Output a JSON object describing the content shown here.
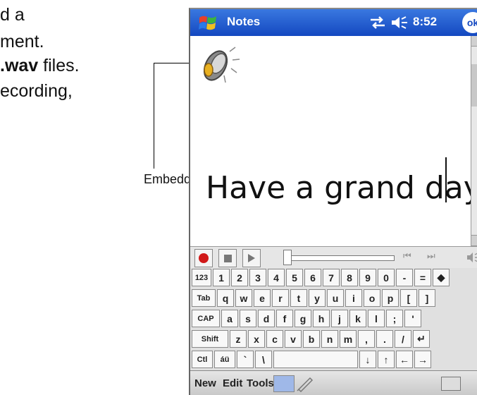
{
  "manual": {
    "line1": "d a",
    "line2": "ment.",
    "line3_bold": ".wav",
    "line3_rest": " files.",
    "line4": "ecording,",
    "callout_label": "Embedded recording"
  },
  "titlebar": {
    "app_title": "Notes",
    "time": "8:52",
    "ok_label": "ok"
  },
  "note": {
    "text": "Have a grand day!"
  },
  "recording_bar": {
    "skip_back": "⏮",
    "skip_forward": "⏭"
  },
  "keyboard": {
    "rows": [
      [
        "123",
        "1",
        "2",
        "3",
        "4",
        "5",
        "6",
        "7",
        "8",
        "9",
        "0",
        "-",
        "=",
        "◆"
      ],
      [
        "Tab",
        "q",
        "w",
        "e",
        "r",
        "t",
        "y",
        "u",
        "i",
        "o",
        "p",
        "[",
        "]"
      ],
      [
        "CAP",
        "a",
        "s",
        "d",
        "f",
        "g",
        "h",
        "j",
        "k",
        "l",
        ";",
        "'"
      ],
      [
        "Shift",
        "z",
        "x",
        "c",
        "v",
        "b",
        "n",
        "m",
        ",",
        ".",
        "/",
        "↵"
      ],
      [
        "Ctl",
        "áü",
        "`",
        "\\",
        "",
        "↓",
        "↑",
        "←",
        "→"
      ]
    ]
  },
  "menubar": {
    "new_label": "New",
    "edit_label": "Edit",
    "tools_label": "Tools"
  },
  "colors": {
    "titlebar_top": "#3a78e0",
    "titlebar_bottom": "#1448c0",
    "record_red": "#d01818"
  }
}
